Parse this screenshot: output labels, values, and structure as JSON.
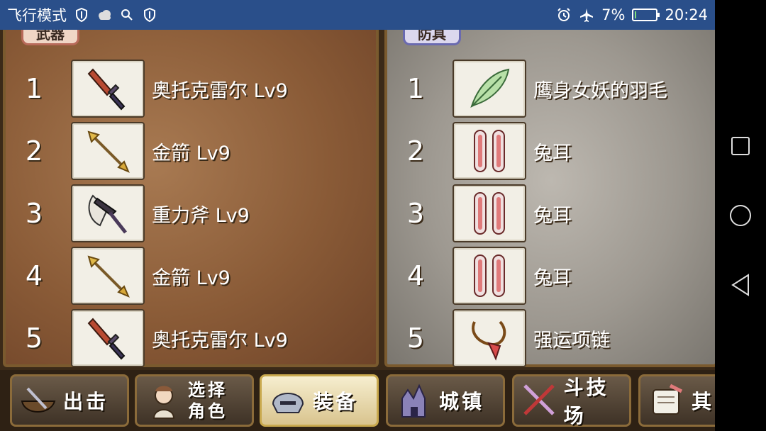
{
  "status_bar": {
    "left_text": "飞行模式",
    "battery": "7%",
    "battery_level": 0.07,
    "time": "20:24"
  },
  "weapons": {
    "title": "武器",
    "items": [
      {
        "num": "1",
        "name": "奥托克雷尔 Lv9",
        "icon": "dark-sword-icon"
      },
      {
        "num": "2",
        "name": "金箭 Lv9",
        "icon": "golden-arrow-icon"
      },
      {
        "num": "3",
        "name": "重力斧 Lv9",
        "icon": "gravity-axe-icon"
      },
      {
        "num": "4",
        "name": "金箭 Lv9",
        "icon": "golden-arrow-icon"
      },
      {
        "num": "5",
        "name": "奥托克雷尔 Lv9",
        "icon": "dark-sword-icon"
      }
    ]
  },
  "armor": {
    "title": "防具",
    "items": [
      {
        "num": "1",
        "name": "鹰身女妖的羽毛",
        "icon": "feather-icon"
      },
      {
        "num": "2",
        "name": "兔耳",
        "icon": "rabbit-ears-icon"
      },
      {
        "num": "3",
        "name": "兔耳",
        "icon": "rabbit-ears-icon"
      },
      {
        "num": "4",
        "name": "兔耳",
        "icon": "rabbit-ears-icon"
      },
      {
        "num": "5",
        "name": "强运项链",
        "icon": "necklace-icon"
      }
    ]
  },
  "nav": {
    "sortie": "出击",
    "select_char_1": "选择",
    "select_char_2": "角色",
    "equip": "装备",
    "town": "城镇",
    "arena": "斗技场",
    "other": "其"
  }
}
